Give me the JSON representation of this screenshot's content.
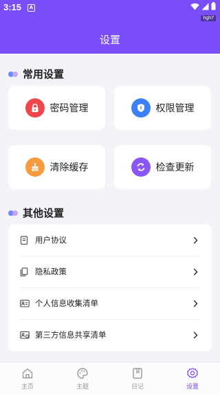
{
  "status": {
    "time": "3:15",
    "app_badge": "A",
    "tag": "hgh7"
  },
  "header": {
    "title": "设置"
  },
  "common": {
    "title": "常用设置",
    "cards": [
      {
        "label": "密码管理",
        "icon": "lock-icon",
        "color": "#f0454a"
      },
      {
        "label": "权限管理",
        "icon": "shield-icon",
        "color": "#3c82f6"
      },
      {
        "label": "清除缓存",
        "icon": "broom-icon",
        "color": "#f99a3f"
      },
      {
        "label": "检查更新",
        "icon": "refresh-icon",
        "color": "#8a56f5"
      }
    ]
  },
  "other": {
    "title": "其他设置",
    "items": [
      {
        "label": "用户协议",
        "icon": "document-icon"
      },
      {
        "label": "隐私政策",
        "icon": "copy-document-icon"
      },
      {
        "label": "个人信息收集清单",
        "icon": "id-card-icon"
      },
      {
        "label": "第三方信息共享清单",
        "icon": "share-card-icon"
      }
    ]
  },
  "tabs": [
    {
      "label": "主页",
      "icon": "home-icon",
      "active": false
    },
    {
      "label": "主题",
      "icon": "palette-icon",
      "active": false
    },
    {
      "label": "日记",
      "icon": "bookmark-book-icon",
      "active": false
    },
    {
      "label": "设置",
      "icon": "gear-icon",
      "active": true
    }
  ],
  "colors": {
    "accent": "#7a4dfb",
    "background": "#f4f4f8"
  }
}
